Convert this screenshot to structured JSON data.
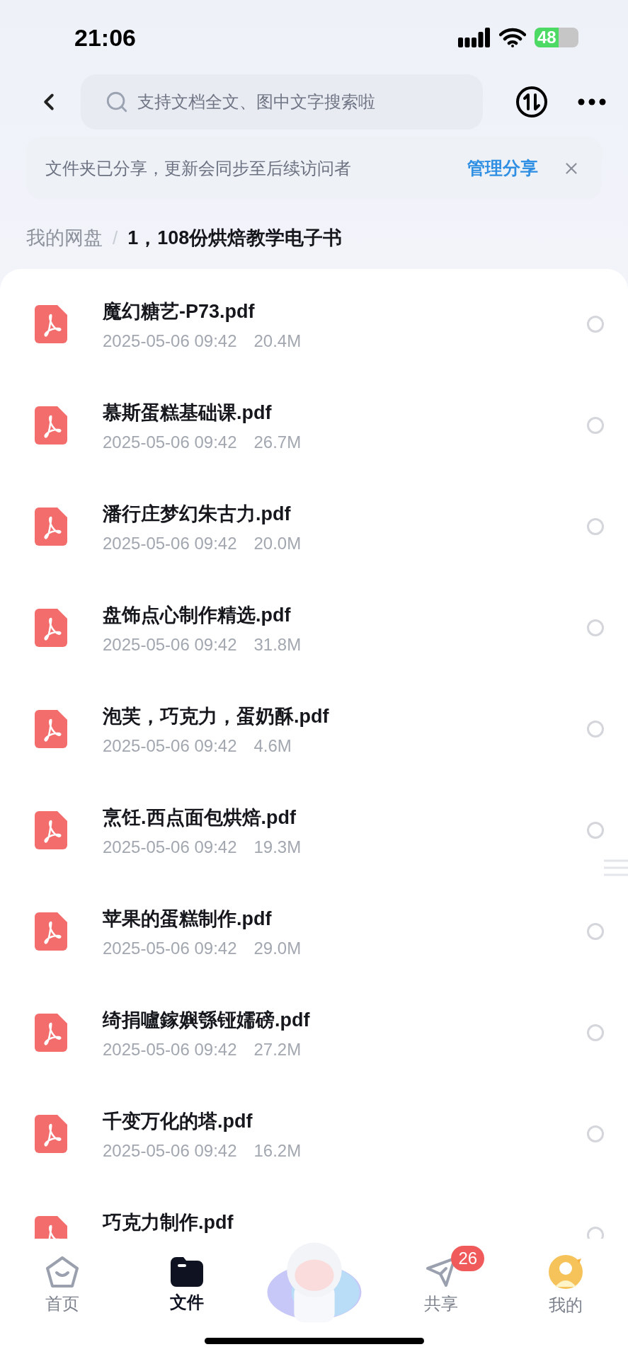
{
  "status_bar": {
    "time": "21:06",
    "battery": "48"
  },
  "search": {
    "placeholder": "支持文档全文、图中文字搜索啦"
  },
  "banner": {
    "text": "文件夹已分享，更新会同步至后续访问者",
    "link": "管理分享"
  },
  "breadcrumb": {
    "separator": "/",
    "items": [
      {
        "label": "我的网盘",
        "current": false
      },
      {
        "label": "1，108份烘焙教学电子书",
        "current": true
      }
    ]
  },
  "files": [
    {
      "name": "魔幻糖艺-P73.pdf",
      "date": "2025-05-06 09:42",
      "size": "20.4M",
      "selected": false
    },
    {
      "name": "慕斯蛋糕基础课.pdf",
      "date": "2025-05-06 09:42",
      "size": "26.7M",
      "selected": false
    },
    {
      "name": "潘行庄梦幻朱古力.pdf",
      "date": "2025-05-06 09:42",
      "size": "20.0M",
      "selected": false
    },
    {
      "name": "盘饰点心制作精选.pdf",
      "date": "2025-05-06 09:42",
      "size": "31.8M",
      "selected": false
    },
    {
      "name": "泡芙，巧克力，蛋奶酥.pdf",
      "date": "2025-05-06 09:42",
      "size": "4.6M",
      "selected": false
    },
    {
      "name": "烹饪.西点面包烘焙.pdf",
      "date": "2025-05-06 09:42",
      "size": "19.3M",
      "selected": false
    },
    {
      "name": "苹果的蛋糕制作.pdf",
      "date": "2025-05-06 09:42",
      "size": "29.0M",
      "selected": false
    },
    {
      "name": "绮捐嚧鎵嬩綔铔嬬磅.pdf",
      "date": "2025-05-06 09:42",
      "size": "27.2M",
      "selected": false
    },
    {
      "name": "千变万化的塔.pdf",
      "date": "2025-05-06 09:42",
      "size": "16.2M",
      "selected": false
    },
    {
      "name": "巧克力制作.pdf",
      "selected": false
    }
  ],
  "tabs": [
    {
      "kind": "home",
      "label": "首页",
      "selected": false
    },
    {
      "kind": "files",
      "label": "文件",
      "selected": true
    },
    {
      "kind": "mascot"
    },
    {
      "kind": "share",
      "label": "共享",
      "selected": false,
      "badge": "26"
    },
    {
      "kind": "me",
      "label": "我的",
      "selected": false
    }
  ]
}
